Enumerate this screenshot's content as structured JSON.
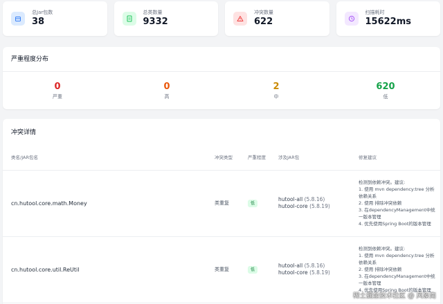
{
  "stats": [
    {
      "label": "总Jar包数",
      "value": "38",
      "icon": "jar-icon",
      "color": "#3b82f6",
      "bg": "#dbeafe"
    },
    {
      "label": "总类数量",
      "value": "9332",
      "icon": "document-icon",
      "color": "#22c55e",
      "bg": "#dcfce7"
    },
    {
      "label": "冲突数量",
      "value": "622",
      "icon": "warning-icon",
      "color": "#ef4444",
      "bg": "#fee2e2"
    },
    {
      "label": "扫描耗时",
      "value": "15622ms",
      "icon": "clock-icon",
      "color": "#a855f7",
      "bg": "#f3e8ff"
    }
  ],
  "severity": {
    "title": "严重程度分布",
    "items": [
      {
        "value": "0",
        "label": "严重",
        "color": "#dc2626"
      },
      {
        "value": "0",
        "label": "高",
        "color": "#ea580c"
      },
      {
        "value": "2",
        "label": "中",
        "color": "#ca8a04"
      },
      {
        "value": "620",
        "label": "低",
        "color": "#16a34a"
      }
    ]
  },
  "details": {
    "title": "冲突详情",
    "headers": {
      "name": "类名/JAR包名",
      "type": "冲突类型",
      "severity": "严重程度",
      "jars": "涉及JAR包",
      "suggestion": "修复建议"
    },
    "rows": [
      {
        "name": "cn.hutool.core.math.Money",
        "type": "类重复",
        "severity": "低",
        "jars": [
          {
            "name": "hutool-all",
            "version": "(5.8.16)"
          },
          {
            "name": "hutool-core",
            "version": "(5.8.19)"
          }
        ],
        "suggestion": [
          "检测到依赖冲突。建议:",
          "1. 使用 mvn dependency:tree 分析依赖关系",
          "2. 使用 排除冲突依赖",
          "3. 在dependencyManagement中统一版本管理",
          "4. 优先使用Spring Boot的版本管理"
        ]
      },
      {
        "name": "cn.hutool.core.util.ReUtil",
        "type": "类重复",
        "severity": "低",
        "jars": [
          {
            "name": "hutool-all",
            "version": "(5.8.16)"
          },
          {
            "name": "hutool-core",
            "version": "(5.8.19)"
          }
        ],
        "suggestion": [
          "检测到依赖冲突。建议:",
          "1. 使用 mvn dependency:tree 分析依赖关系",
          "2. 使用 排除冲突依赖",
          "3. 在dependencyManagement中统一版本管理",
          "4. 优先使用Spring Boot的版本管理"
        ]
      }
    ]
  },
  "watermark": "稀土掘金技术社区 @ 风象南"
}
